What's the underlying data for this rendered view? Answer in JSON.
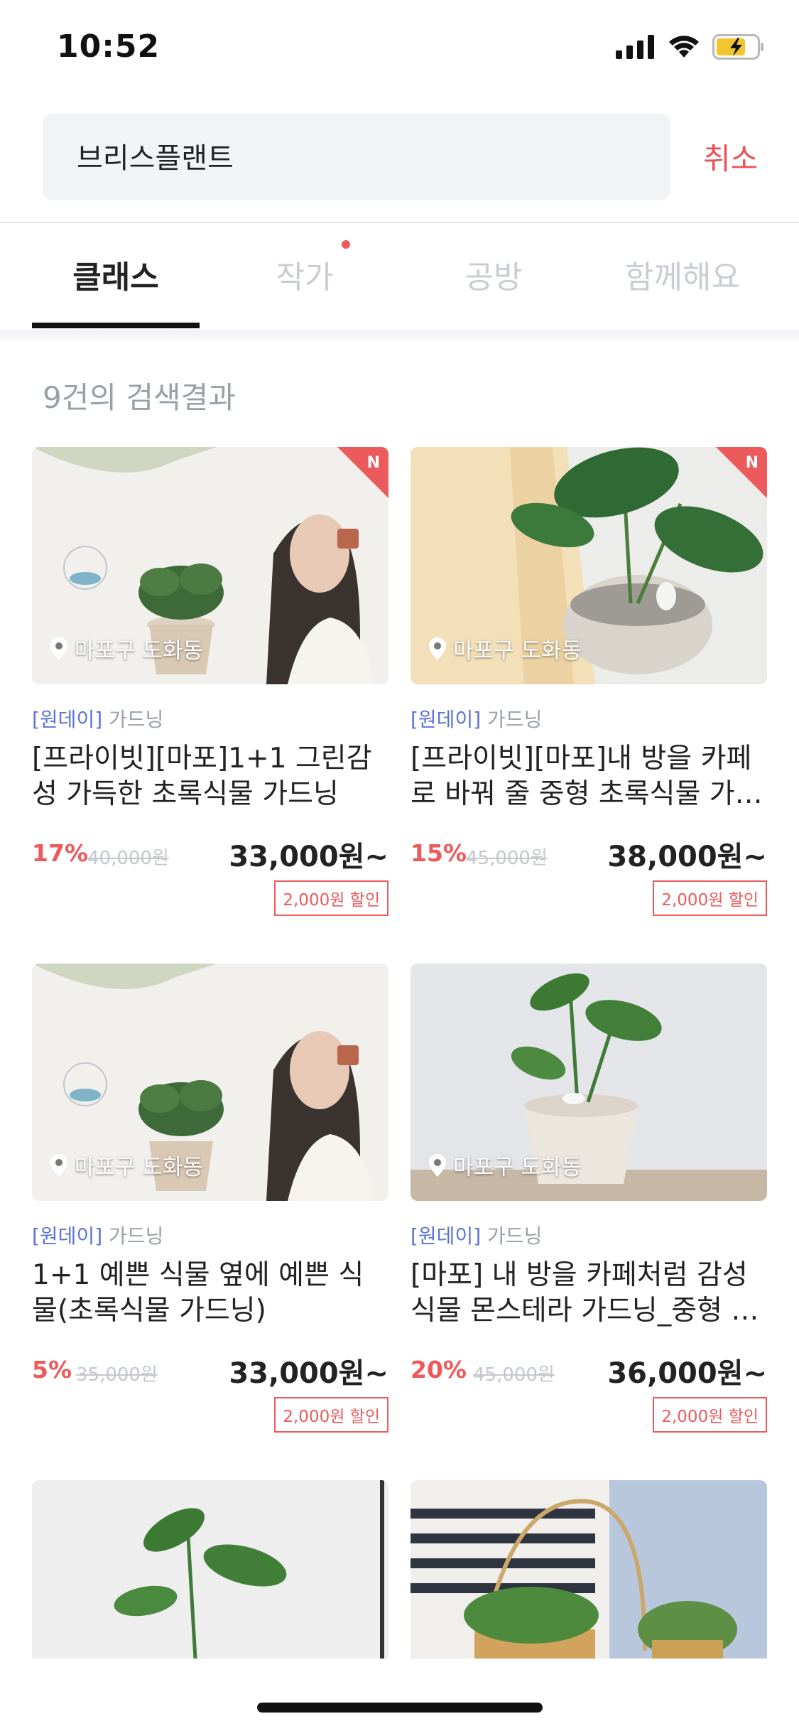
{
  "status_bar": {
    "time": "10:52"
  },
  "search": {
    "query": "브리스플랜트",
    "cancel_label": "취소"
  },
  "tabs": [
    {
      "label": "클래스",
      "active": true
    },
    {
      "label": "작가",
      "active": false,
      "has_dot": true
    },
    {
      "label": "공방",
      "active": false
    },
    {
      "label": "함께해요",
      "active": false
    }
  ],
  "result_count": "9건의 검색결과",
  "cards": [
    {
      "location": "마포구 도화동",
      "badge": "N",
      "type": "[원데이]",
      "category": "가드닝",
      "title": "[프라이빗][마포]1+1 그린감성 가득한 초록식물 가드닝",
      "discount": "17%",
      "original_price": "40,000원",
      "price": "33,000원~",
      "coupon": "2,000원 할인"
    },
    {
      "location": "마포구 도화동",
      "badge": "N",
      "type": "[원데이]",
      "category": "가드닝",
      "title": "[프라이빗][마포]내 방을 카페로 바꿔 줄 중형 초록식물 가드닝",
      "discount": "15%",
      "original_price": "45,000원",
      "price": "38,000원~",
      "coupon": "2,000원 할인"
    },
    {
      "location": "마포구 도화동",
      "type": "[원데이]",
      "category": "가드닝",
      "title": "1+1 예쁜 식물 옆에 예쁜 식물(초록식물 가드닝)",
      "discount": "5%",
      "original_price": "35,000원",
      "price": "33,000원~",
      "coupon": "2,000원 할인"
    },
    {
      "location": "마포구 도화동",
      "type": "[원데이]",
      "category": "가드닝",
      "title": "[마포] 내 방을 카페처럼 감성 식물 몬스테라 가드닝_중형 화분",
      "discount": "20%",
      "original_price": "45,000원",
      "price": "36,000원~",
      "coupon": "2,000원 할인"
    }
  ]
}
